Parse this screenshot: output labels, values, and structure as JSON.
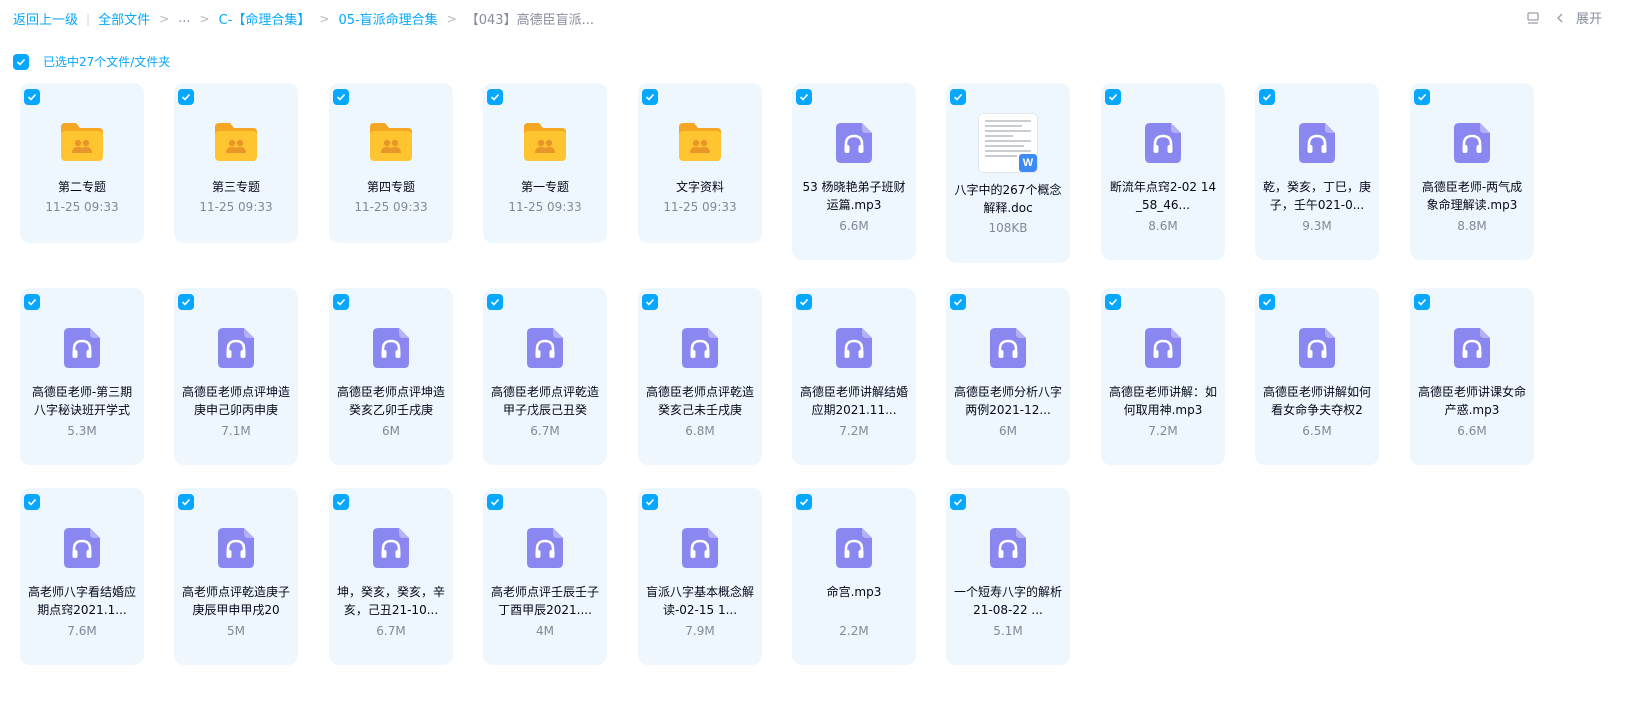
{
  "breadcrumb": {
    "back": "返回上一级",
    "items": [
      "全部文件",
      "...",
      "C-【命理合集】",
      "05-盲派命理合集",
      "【043】高德臣盲派..."
    ]
  },
  "toolbar": {
    "expand_label": "展开"
  },
  "selection": {
    "text": "已选中27个文件/文件夹"
  },
  "colors": {
    "accent": "#06a7ff",
    "card_bg": "#eef7fd",
    "audio_icon": "#8a87f0",
    "folder": "#ffc530"
  },
  "files": [
    {
      "name": "第二专题",
      "meta": "11-25 09:33",
      "type": "folder"
    },
    {
      "name": "第三专题",
      "meta": "11-25 09:33",
      "type": "folder"
    },
    {
      "name": "第四专题",
      "meta": "11-25 09:33",
      "type": "folder"
    },
    {
      "name": "第一专题",
      "meta": "11-25 09:33",
      "type": "folder"
    },
    {
      "name": "文字资料",
      "meta": "11-25 09:33",
      "type": "folder"
    },
    {
      "name": "53 杨晓艳弟子班财运篇.mp3",
      "meta": "6.6M",
      "type": "audio"
    },
    {
      "name": "八字中的267个概念解释.doc",
      "meta": "108KB",
      "type": "doc"
    },
    {
      "name": "断流年点窍2-02 14_58_46...",
      "meta": "8.6M",
      "type": "audio"
    },
    {
      "name": "乾，癸亥，丁巳，庚子，壬午021-0...",
      "meta": "9.3M",
      "type": "audio"
    },
    {
      "name": "高德臣老师-两气成象命理解读.mp3",
      "meta": "8.8M",
      "type": "audio"
    },
    {
      "name": "高德臣老师-第三期八字秘诀班开学式",
      "meta": "5.3M",
      "type": "audio"
    },
    {
      "name": "高德臣老师点评坤造庚申己卯丙申庚",
      "meta": "7.1M",
      "type": "audio"
    },
    {
      "name": "高德臣老师点评坤造癸亥乙卯壬戌庚",
      "meta": "6M",
      "type": "audio"
    },
    {
      "name": "高德臣老师点评乾造甲子戊辰己丑癸",
      "meta": "6.7M",
      "type": "audio"
    },
    {
      "name": "高德臣老师点评乾造癸亥己未壬戌庚",
      "meta": "6.8M",
      "type": "audio"
    },
    {
      "name": "高德臣老师讲解结婚应期2021.11...",
      "meta": "7.2M",
      "type": "audio"
    },
    {
      "name": "高德臣老师分析八字两例2021-12...",
      "meta": "6M",
      "type": "audio"
    },
    {
      "name": "高德臣老师讲解：如何取用神.mp3",
      "meta": "7.2M",
      "type": "audio"
    },
    {
      "name": "高德臣老师讲解如何看女命争夫夺权2",
      "meta": "6.5M",
      "type": "audio"
    },
    {
      "name": "高德臣老师讲课女命产惑.mp3",
      "meta": "6.6M",
      "type": "audio"
    },
    {
      "name": "高老师八字看结婚应期点窍2021.1...",
      "meta": "7.6M",
      "type": "audio"
    },
    {
      "name": "高老师点评乾造庚子庚辰甲申甲戌20",
      "meta": "5M",
      "type": "audio"
    },
    {
      "name": "坤，癸亥，癸亥，辛亥，己丑21-10...",
      "meta": "6.7M",
      "type": "audio"
    },
    {
      "name": "高老师点评壬辰壬子丁酉甲辰2021....",
      "meta": "4M",
      "type": "audio"
    },
    {
      "name": "盲派八字基本概念解读-02-15 1...",
      "meta": "7.9M",
      "type": "audio"
    },
    {
      "name": "命宫.mp3",
      "meta": "2.2M",
      "type": "audio"
    },
    {
      "name": "一个短寿八字的解析21-08-22 ...",
      "meta": "5.1M",
      "type": "audio"
    }
  ]
}
